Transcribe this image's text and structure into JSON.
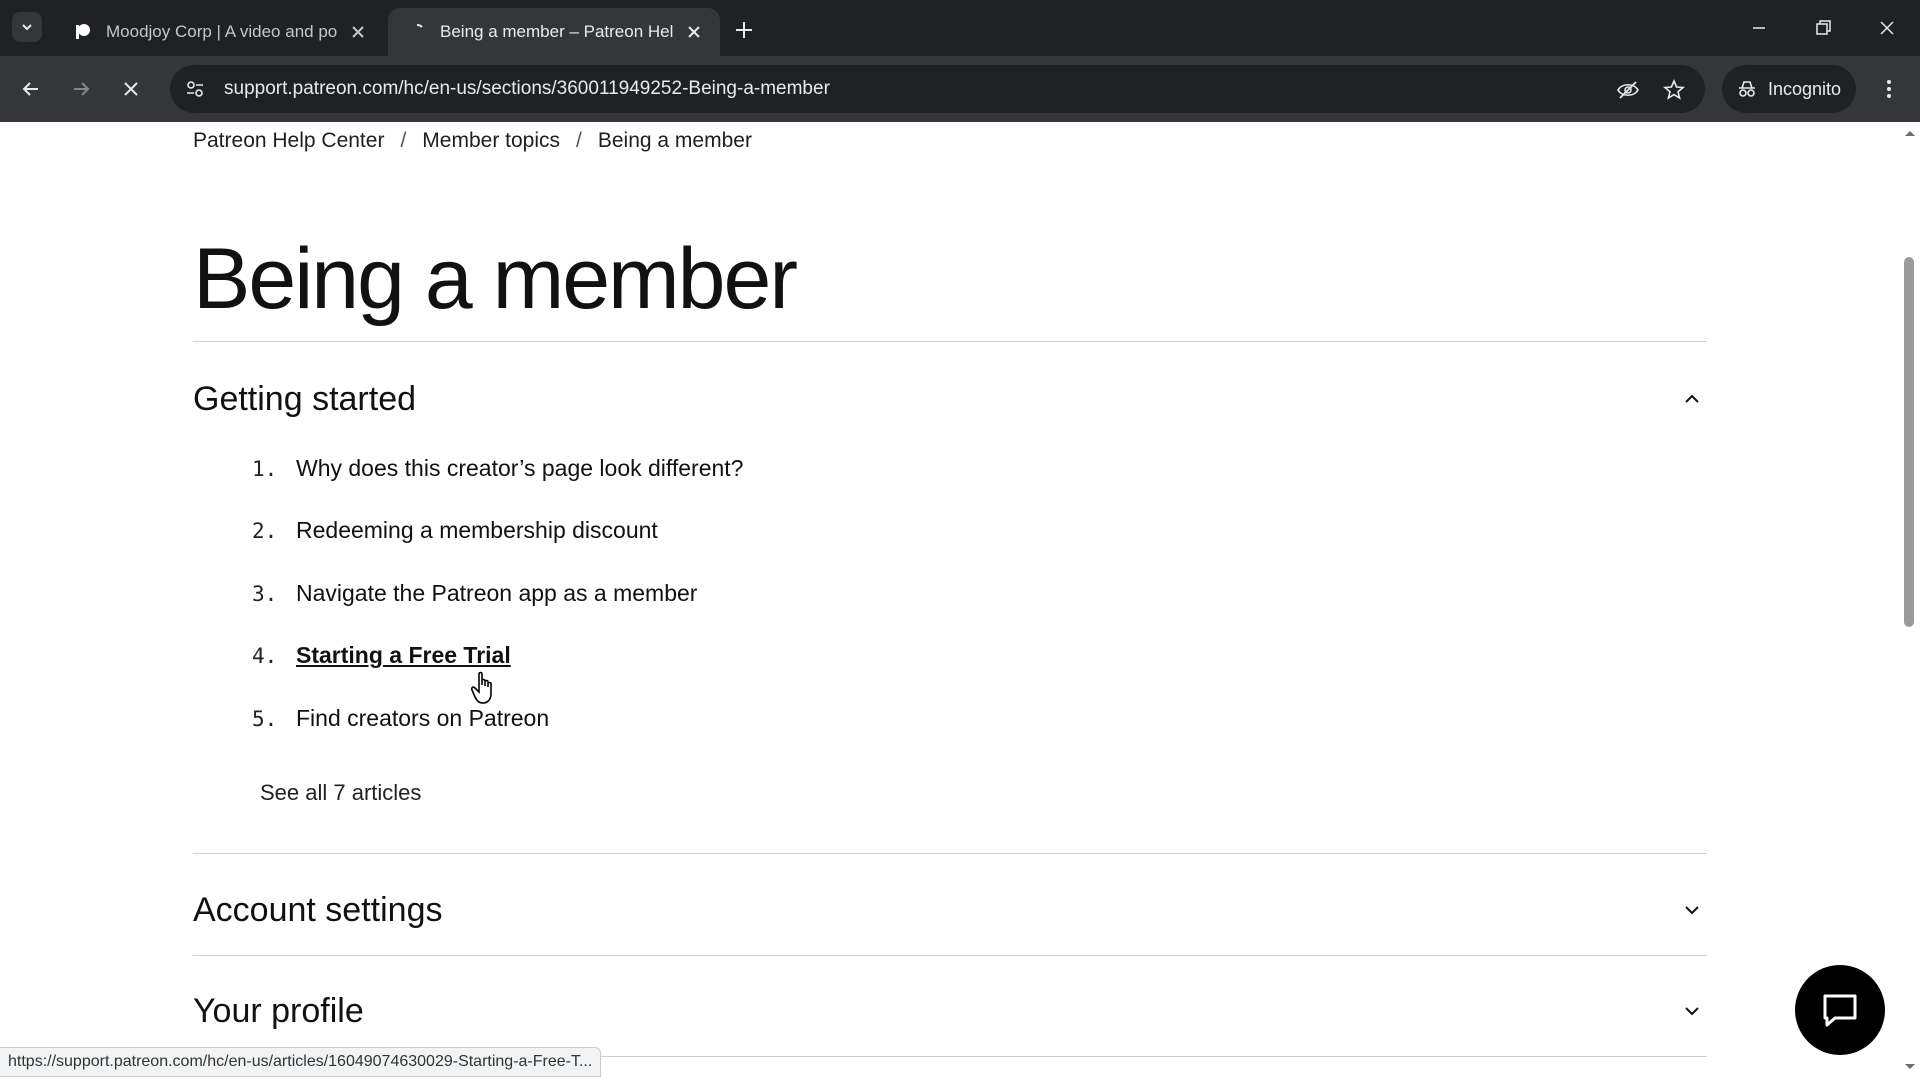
{
  "browser": {
    "tabs": [
      {
        "title": "Moodjoy Corp | A video and po",
        "active": false
      },
      {
        "title": "Being a member – Patreon Help",
        "active": true
      }
    ],
    "url": "support.patreon.com/hc/en-us/sections/360011949252-Being-a-member",
    "incognito_label": "Incognito",
    "status_url": "https://support.patreon.com/hc/en-us/articles/16049074630029-Starting-a-Free-T..."
  },
  "breadcrumb": [
    "Patreon Help Center",
    "Member topics",
    "Being a member"
  ],
  "page_title": "Being a member",
  "sections": [
    {
      "title": "Getting started",
      "expanded": true,
      "articles": [
        {
          "num": "1.",
          "title": "Why does this creator’s page look different?"
        },
        {
          "num": "2.",
          "title": "Redeeming a membership discount"
        },
        {
          "num": "3.",
          "title": "Navigate the Patreon app as a member"
        },
        {
          "num": "4.",
          "title": "Starting a Free Trial"
        },
        {
          "num": "5.",
          "title": "Find creators on Patreon"
        }
      ],
      "see_all": "See all 7 articles"
    },
    {
      "title": "Account settings",
      "expanded": false
    },
    {
      "title": "Your profile",
      "expanded": false
    }
  ],
  "icons": {
    "chat": "chat-bubble-icon",
    "cursor": "hand-pointer-icon"
  },
  "colors": {
    "chrome_dark": "#202124",
    "chrome_toolbar": "#35363a",
    "text": "#111111",
    "chat_button": "#000000"
  }
}
